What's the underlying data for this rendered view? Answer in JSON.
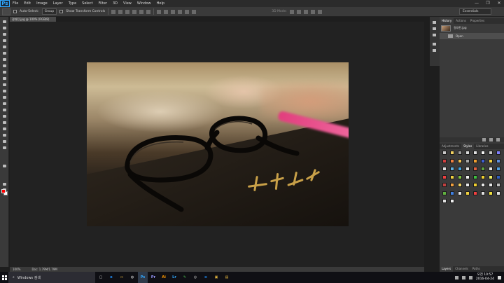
{
  "app": {
    "logo": "Ps"
  },
  "menu": [
    "File",
    "Edit",
    "Image",
    "Layer",
    "Type",
    "Select",
    "Filter",
    "3D",
    "View",
    "Window",
    "Help"
  ],
  "window_controls": [
    "—",
    "❐",
    "✕"
  ],
  "options": {
    "auto_select_label": "Auto-Select:",
    "auto_select_value": "Group",
    "transform_controls_label": "Show Transform Controls",
    "mode_3d_label": "3D Mode:",
    "workspace": "Essentials"
  },
  "document": {
    "tab_title": "걸대된.jpg @ 100% (RGB/8)",
    "zoom": "100%",
    "doc_size": "Doc: 1.79M/1.79M"
  },
  "history": {
    "tabs": [
      "History",
      "Actions",
      "Properties"
    ],
    "snapshot_label": "걸대된.jpg",
    "open_step": "Open"
  },
  "swatches": {
    "tabs": [
      "Adjustments",
      "Styles",
      "Libraries"
    ],
    "colors": [
      "#c8c8c8",
      "#f0d060",
      "#9a9a9a",
      "#d8d8d8",
      "#e0e0e0",
      "#f2f2f2",
      "#c8c8c8",
      "#8080ff",
      "#d04040",
      "#f08040",
      "#f0c050",
      "#a8a8a8",
      "#f0a030",
      "#4060d0",
      "#f0d040",
      "#6090e0",
      "#e0e0e0",
      "#60b0e0",
      "#40a0e0",
      "#e0e0e0",
      "#e06040",
      "#60a040",
      "#e8e8e8",
      "#50a0e0",
      "#f04040",
      "#f0d040",
      "#80c040",
      "#f0f0f0",
      "#40c040",
      "#f0d030",
      "#f0f060",
      "#3060c0",
      "#c04040",
      "#f0a040",
      "#f0d060",
      "#e8e8e8",
      "#f0d030",
      "#e8e8e8",
      "#e8e8e8",
      "#c0c0c0",
      "#60b040",
      "#4080e0",
      "#e0e0e0",
      "#f0d040",
      "#f04040",
      "#e0e0e0",
      "#f0e040",
      "#e0e0e0",
      "#e0e0e0",
      "#f0f0f0"
    ]
  },
  "layers": {
    "tabs": [
      "Layers",
      "Channels",
      "Paths"
    ]
  },
  "taskbar": {
    "search_placeholder": "Windows 검색",
    "apps": [
      {
        "glyph": "e",
        "color": "#1e90ff"
      },
      {
        "glyph": "▭",
        "color": "#f0c040"
      },
      {
        "glyph": "◍",
        "color": "#e0e0e0"
      },
      {
        "glyph": "Ps",
        "color": "#31a8ff"
      },
      {
        "glyph": "Pr",
        "color": "#9999ff"
      },
      {
        "glyph": "Ai",
        "color": "#ff9a00"
      },
      {
        "glyph": "Lr",
        "color": "#31a8ff"
      },
      {
        "glyph": "✎",
        "color": "#4cc050"
      },
      {
        "glyph": "◎",
        "color": "#d8d8d8"
      },
      {
        "glyph": "≡",
        "color": "#1e90ff"
      },
      {
        "glyph": "▣",
        "color": "#f0c040"
      },
      {
        "glyph": "▤",
        "color": "#f0c040"
      }
    ],
    "time": "오전 10:57",
    "date": "2016-04-24"
  }
}
